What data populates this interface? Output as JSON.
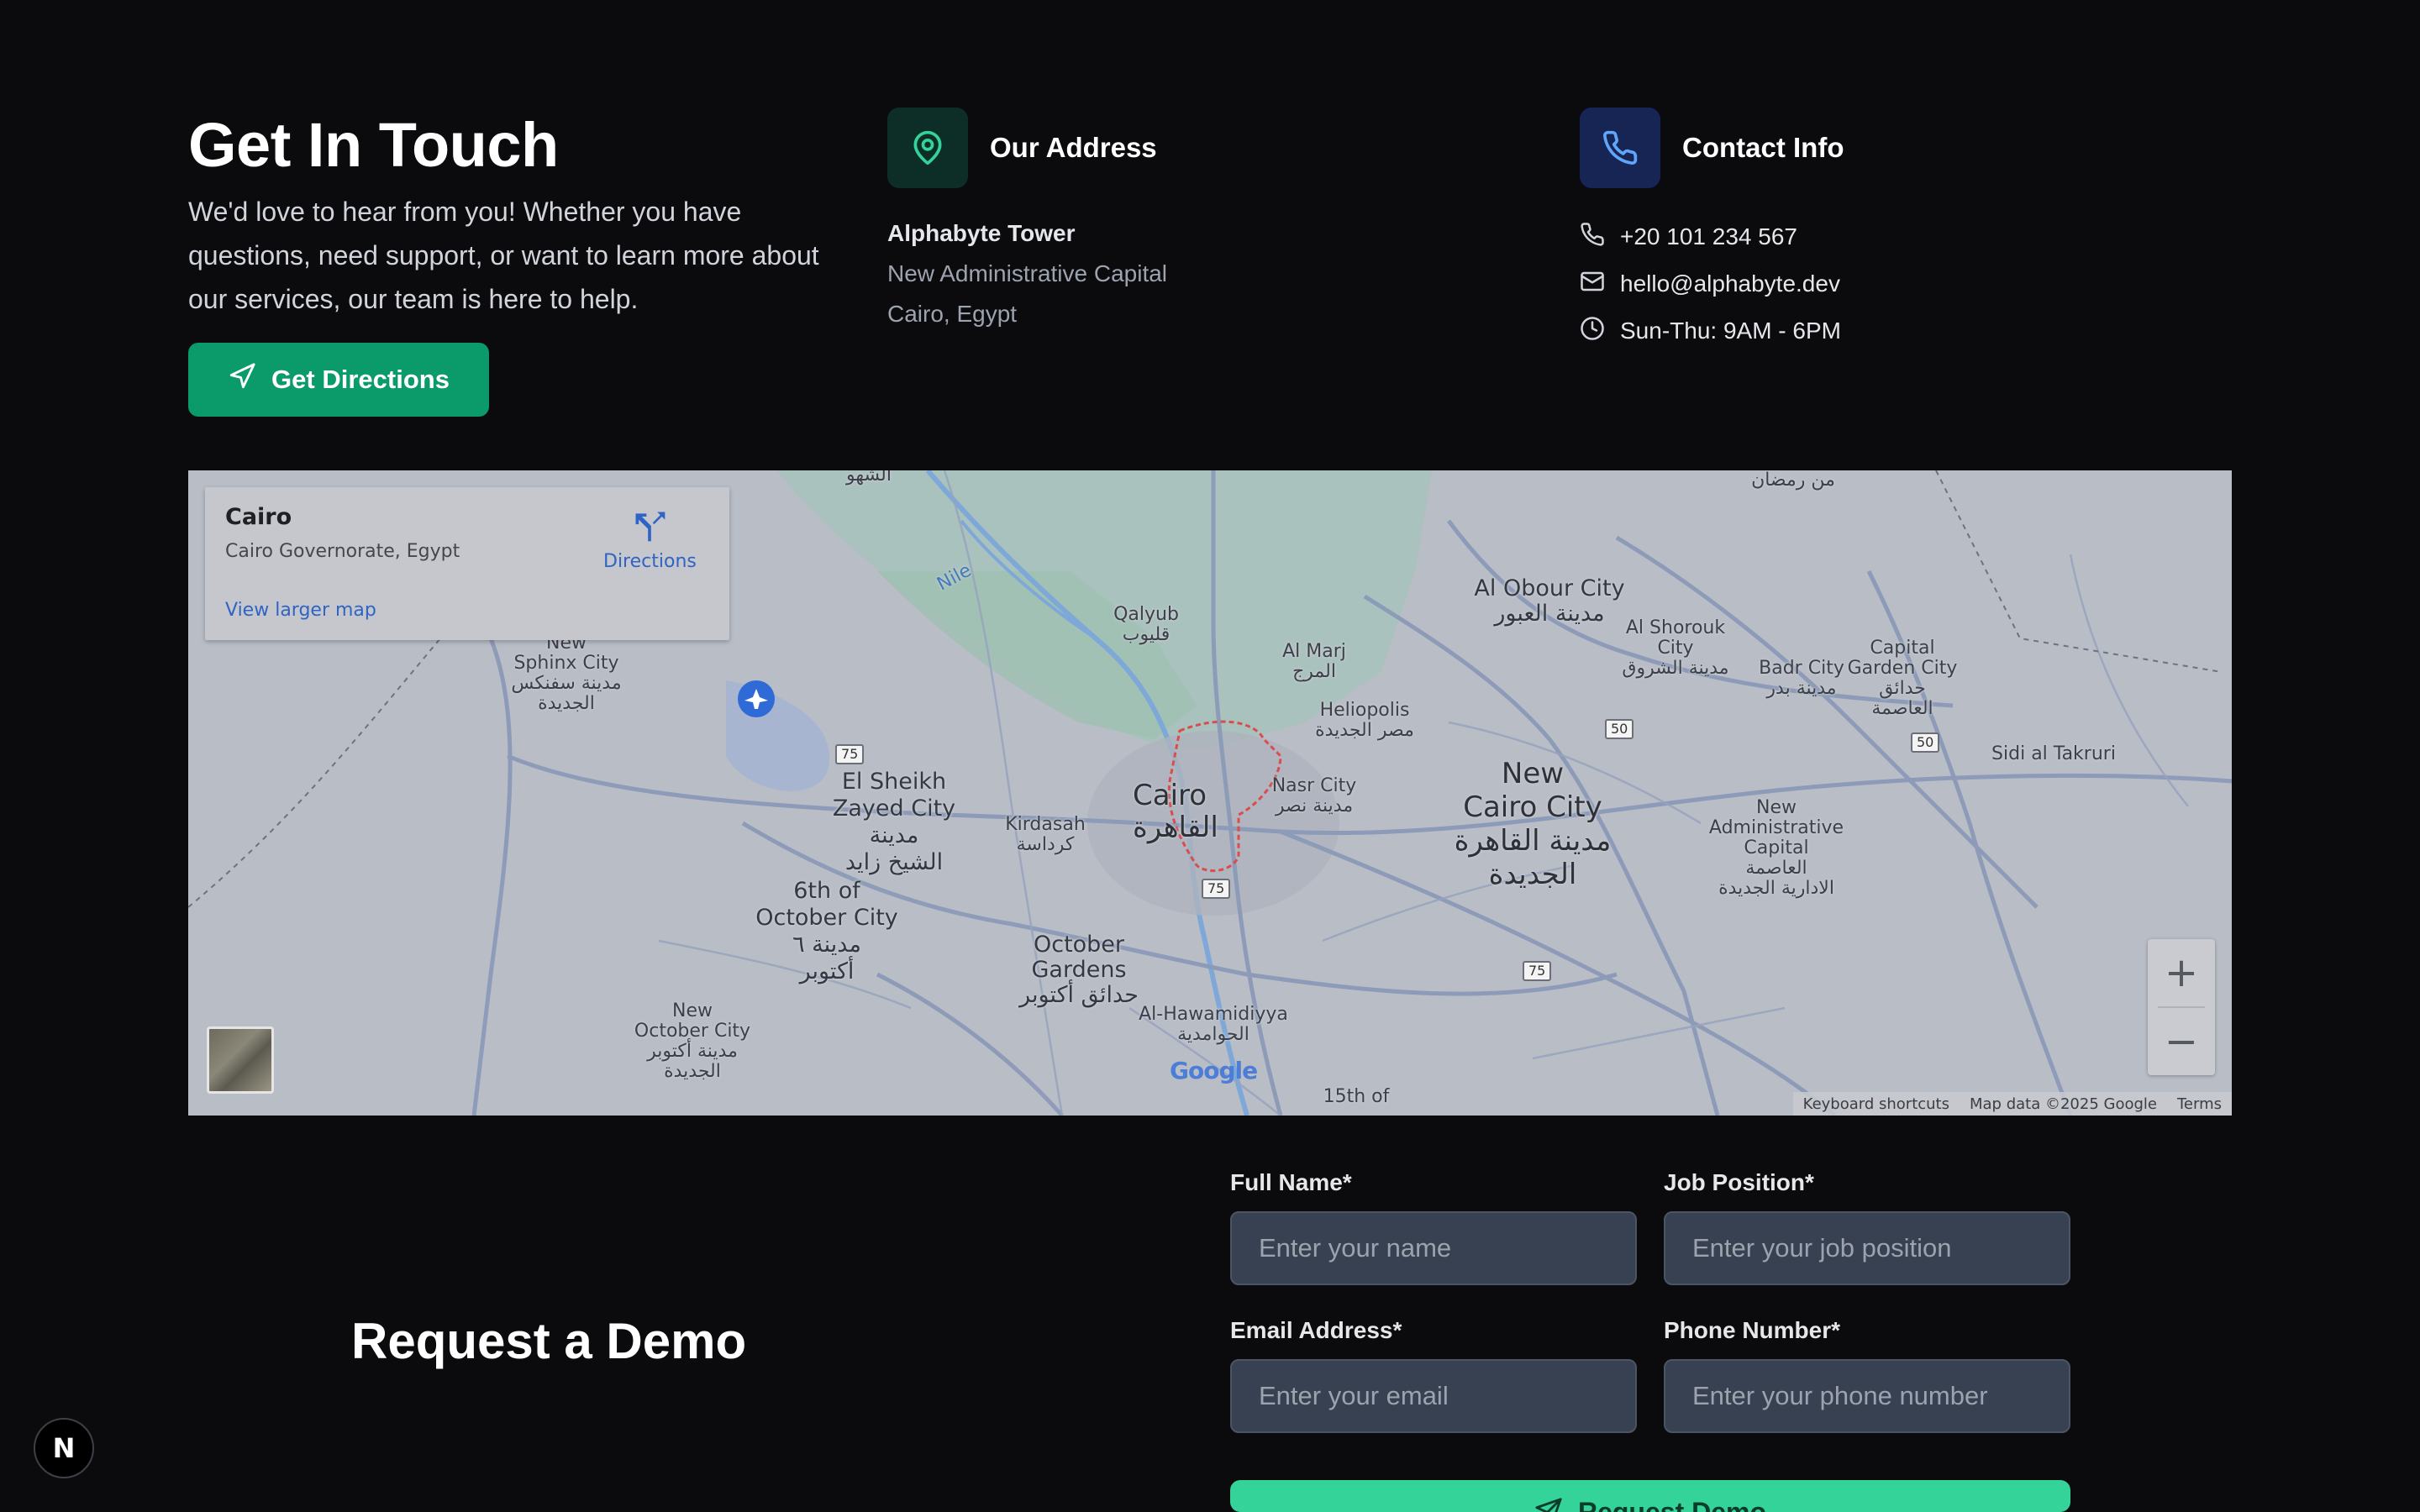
{
  "hero": {
    "title": "Get In Touch",
    "description": "We'd love to hear from you! Whether you have questions, need support, or want to learn more about our services, our team is here to help.",
    "directions_button": "Get Directions",
    "accent_color": "#0b9b6a"
  },
  "address": {
    "title": "Our Address",
    "icon": "map-pin-icon",
    "lines": [
      "Alphabyte Tower",
      "New Administrative Capital",
      "Cairo, Egypt"
    ]
  },
  "contact": {
    "title": "Contact Info",
    "icon": "phone-icon",
    "phone": "+20 101 234 567",
    "email": "hello@alphabyte.dev",
    "hours": "Sun-Thu: 9AM - 6PM"
  },
  "map": {
    "place_name": "Cairo",
    "place_region": "Cairo Governorate, Egypt",
    "directions_label": "Directions",
    "view_larger": "View larger map",
    "zoom_in": "+",
    "zoom_out": "−",
    "google": "Google",
    "footer": {
      "shortcuts": "Keyboard shortcuts",
      "map_data": "Map data ©2025 Google",
      "terms": "Terms"
    },
    "labels": {
      "cairo": "Cairo",
      "cairo_ar": "القاهرة",
      "new_cairo_1": "New",
      "new_cairo_2": "Cairo City",
      "new_cairo_ar1": "مدينة القاهرة",
      "new_cairo_ar2": "الجديدة",
      "sheikh_1": "El Sheikh",
      "sheikh_2": "Zayed City",
      "sheikh_ar1": "مدينة",
      "sheikh_ar2": "الشيخ زايد",
      "october_1": "6th of",
      "october_2": "October City",
      "october_ar1": "مدينة ٦",
      "october_ar2": "أكتوبر",
      "gardens_1": "October",
      "gardens_2": "Gardens",
      "gardens_ar": "حدائق أكتوبر",
      "obour": "Al Obour City",
      "obour_ar": "مدينة العبور",
      "qalyub": "Qalyub",
      "qalyub_ar": "قليوب",
      "marj": "Al Marj",
      "marj_ar": "المرج",
      "heliopolis": "Heliopolis",
      "heliopolis_ar": "مصر الجديدة",
      "nasr": "Nasr City",
      "nasr_ar": "مدينة نصر",
      "kirdasah": "Kirdasah",
      "kirdasah_ar": "كرداسة",
      "sphinx_0": "New",
      "sphinx_1": "Sphinx City",
      "sphinx_ar1": "مدينة سفنكس",
      "sphinx_ar2": "الجديدة",
      "shorouk_1": "Al Shorouk",
      "shorouk_2": "City",
      "shorouk_ar": "مدينة الشروق",
      "badr_1": "Badr City",
      "badr_ar": "مدينة بدر",
      "capgarden_1": "Capital",
      "capgarden_2": "Garden City",
      "capgarden_ar1": "حدائق",
      "capgarden_ar2": "العاصمة",
      "takruri": "Sidi al Takruri",
      "nac_1": "New",
      "nac_2": "Administrative",
      "nac_3": "Capital",
      "nac_ar1": "العاصمة",
      "nac_ar2": "الادارية الجديدة",
      "hawam": "Al-Hawamidiyya",
      "hawam_ar": "الحوامدية",
      "newoct_1": "New",
      "newoct_2": "October City",
      "newoct_ar1": "مدينة أكتوبر",
      "newoct_ar2": "الجديدة",
      "fifteenth": "15th of",
      "ramadan_ar": "من رمضان",
      "nile": "Nile",
      "sahwa_ar": "الشهو"
    },
    "shields": [
      "75",
      "75",
      "50",
      "50",
      "75"
    ]
  },
  "demo": {
    "title": "Request a Demo",
    "fields": {
      "full_name_label": "Full Name*",
      "full_name_placeholder": "Enter your name",
      "job_label": "Job Position*",
      "job_placeholder": "Enter your job position",
      "email_label": "Email Address*",
      "email_placeholder": "Enter your email",
      "phone_label": "Phone Number*",
      "phone_placeholder": "Enter your phone number"
    },
    "submit_label": "Request Demo",
    "submit_color": "#34d399"
  },
  "dev_badge": "N"
}
